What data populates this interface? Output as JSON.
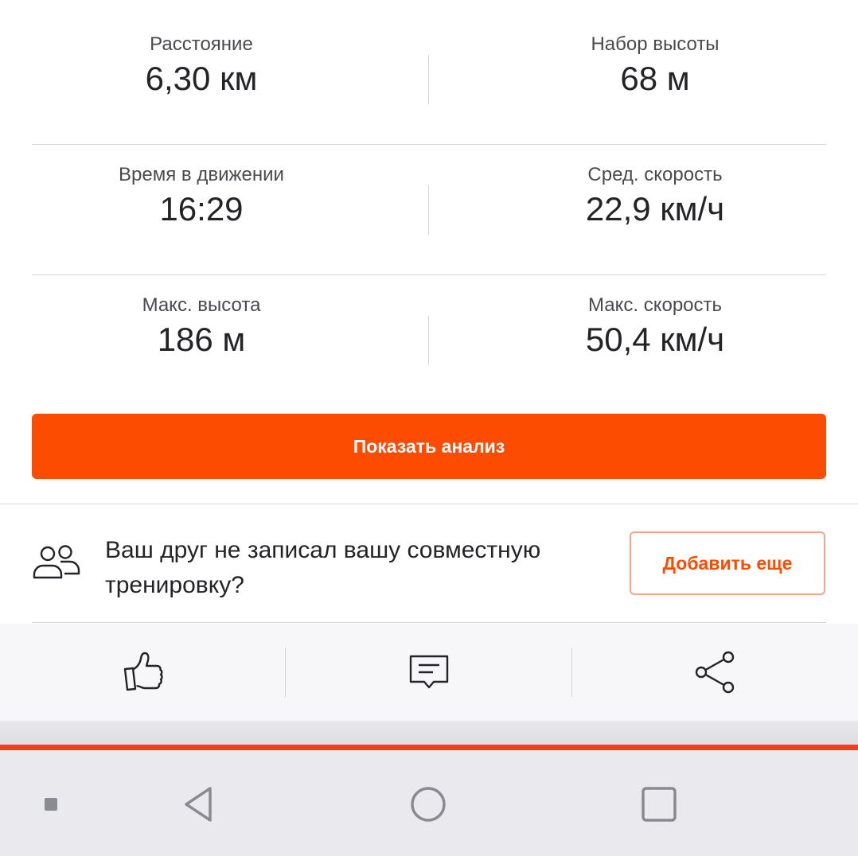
{
  "stats": [
    [
      {
        "label": "Расстояние",
        "value": "6,30 км"
      },
      {
        "label": "Набор высоты",
        "value": "68 м"
      }
    ],
    [
      {
        "label": "Время в движении",
        "value": "16:29"
      },
      {
        "label": "Сред. скорость",
        "value": "22,9 км/ч"
      }
    ],
    [
      {
        "label": "Макс. высота",
        "value": "186 м"
      },
      {
        "label": "Макс. скорость",
        "value": "50,4 км/ч"
      }
    ]
  ],
  "analysis": {
    "button_label": "Показать анализ"
  },
  "friend_prompt": {
    "text": "Ваш друг не записал вашу совместную тренировку?",
    "button_label": "Добавить еще",
    "icon": "people-icon"
  },
  "actions": {
    "kudos_icon": "thumbs-up-icon",
    "comment_icon": "comment-icon",
    "share_icon": "share-icon"
  },
  "nav": {
    "menu_icon": "small-square-icon",
    "back_icon": "back-triangle-icon",
    "home_icon": "home-circle-icon",
    "recents_icon": "recents-square-icon"
  },
  "colors": {
    "accent": "#fc4c02",
    "accent_line": "#fc3c1a",
    "text": "#242428",
    "secondary_text": "#494950"
  }
}
